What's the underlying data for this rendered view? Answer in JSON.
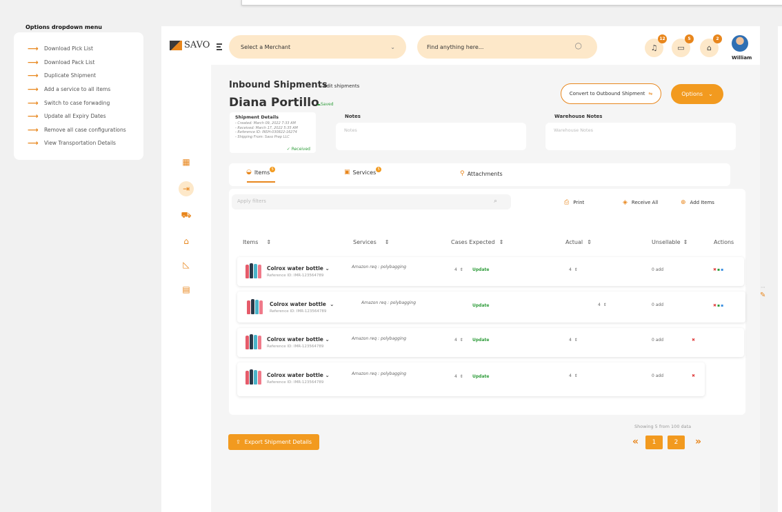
{
  "dropdown": {
    "title": "Options dropdown menu",
    "items": [
      "Download Pick List",
      "Download Pack List",
      "Duplicate Shipment",
      "Add a service to all items",
      "Switch to case forwading",
      "Update all Expiry Dates",
      "Remove all case configurations",
      "View Transportation Details"
    ]
  },
  "brand": {
    "name": "SAVO",
    "accent": "#f29a1f",
    "light": "#fde8c9"
  },
  "header": {
    "merchant_placeholder": "Select a Merchant",
    "search_placeholder": "Find anything here...",
    "notif_count": "12",
    "messages_count": "5",
    "gifts_count": "2",
    "user_name": "William"
  },
  "page": {
    "title": "Inbound Shipments",
    "breadcrumb": "Edit shipments",
    "name": "Diana Portillo",
    "saved": "Saved",
    "convert_label": "Convert to Outbound Shipment",
    "options_label": "Options"
  },
  "shipment": {
    "heading": "Shipment Details",
    "lines": [
      "- Created: March 09, 2022 7:33 AM",
      "- Received: March 17, 2022 5:35 AM",
      "- Reference ID: INSH-030822-16274",
      "- Shipping From: Savo Prep LLC"
    ],
    "status": "Received"
  },
  "notes": {
    "label": "Notes",
    "placeholder": "Notes",
    "wh_label": "Warehouse Notes",
    "wh_placeholder": "Warehouse Notes"
  },
  "tabs": [
    {
      "label": "Items",
      "count": "5"
    },
    {
      "label": "Services",
      "count": "5"
    },
    {
      "label": "Attachments"
    }
  ],
  "toolbar": {
    "filter_placeholder": "Apply filters",
    "print": "Print",
    "receive_all": "Receive All",
    "add_items": "Add Items"
  },
  "columns": [
    "Items",
    "Services",
    "Cases Expected",
    "Actual",
    "Unsellable",
    "Actions"
  ],
  "rows": [
    {
      "name": "Colrox water bottle",
      "ref": "Reference ID: IMR-123564789",
      "service": "Amazon req : polybagging",
      "cases": "4",
      "update": "Update",
      "actual": "4",
      "unsellable": "0 add"
    },
    {
      "name": "Colrox water bottle",
      "ref": "Reference ID: IMR-123564789",
      "service": "Amazon req : polybagging",
      "cases": "",
      "update": "Update",
      "actual": "4",
      "unsellable": "0 add"
    },
    {
      "name": "Colrox water bottle",
      "ref": "Reference ID: IMR-123564789",
      "service": "Amazon req : polybagging",
      "cases": "4",
      "update": "Update",
      "actual": "4",
      "unsellable": "0 add"
    },
    {
      "name": "Colrox water bottle",
      "ref": "Reference ID: IMR-123564789",
      "service": "Amazon req : polybagging",
      "cases": "4",
      "update": "Update",
      "actual": "4",
      "unsellable": "0 add"
    }
  ],
  "footer": {
    "showing": "Showing 5 from 100 data",
    "export": "Export Shipment Details",
    "pages": [
      "1",
      "2"
    ],
    "prev": "«",
    "next": "»"
  }
}
